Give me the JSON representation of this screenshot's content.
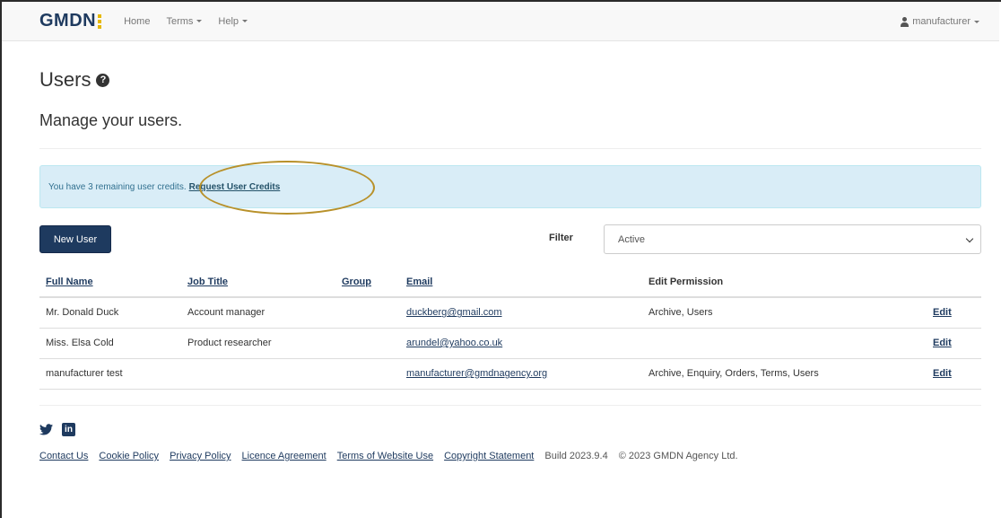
{
  "navbar": {
    "brand": "GMDN",
    "links": [
      {
        "label": "Home"
      },
      {
        "label": "Terms"
      },
      {
        "label": "Help"
      }
    ],
    "user": "manufacturer"
  },
  "header": {
    "title": "Users",
    "help_icon": "?",
    "subtitle": "Manage your users."
  },
  "alert": {
    "text": "You have 3 remaining user credits.",
    "link": "Request User Credits"
  },
  "toolbar": {
    "new_user": "New User",
    "filter_label": "Filter",
    "filter_value": "Active"
  },
  "table": {
    "headers": {
      "full_name": "Full Name",
      "job_title": "Job Title",
      "group": "Group",
      "email": "Email",
      "edit_permission": "Edit Permission"
    },
    "rows": [
      {
        "full_name": "Mr. Donald Duck",
        "job_title": "Account manager",
        "group": "",
        "email": "duckberg@gmail.com",
        "permission": "Archive, Users",
        "edit": "Edit"
      },
      {
        "full_name": "Miss. Elsa Cold",
        "job_title": "Product researcher",
        "group": "",
        "email": "arundel@yahoo.co.uk",
        "permission": "",
        "edit": "Edit"
      },
      {
        "full_name": "manufacturer test",
        "job_title": "",
        "group": "",
        "email": "manufacturer@gmdnagency.org",
        "permission": "Archive, Enquiry, Orders, Terms, Users",
        "edit": "Edit"
      }
    ]
  },
  "footer": {
    "social_icons": [
      "twitter-icon",
      "linkedin-icon"
    ],
    "linkedin_glyph": "in",
    "links": [
      "Contact Us",
      "Cookie Policy",
      "Privacy Policy",
      "Licence Agreement",
      "Terms of Website Use",
      "Copyright Statement"
    ],
    "build": "Build 2023.9.4",
    "copyright": "© 2023 GMDN Agency Ltd."
  },
  "colors": {
    "brand_navy": "#1e3a5f",
    "brand_yellow": "#e6b800",
    "alert_bg": "#d9edf7",
    "annotation_oval": "#b8912a"
  }
}
